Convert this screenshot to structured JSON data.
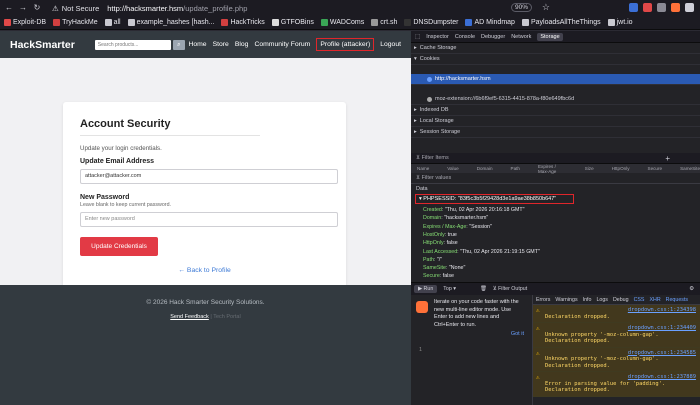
{
  "browser": {
    "security_label": "Not Secure",
    "url_host": "http://hacksmarter.hsm",
    "url_path": "/update_profile.php",
    "zoom": "90%"
  },
  "bookmarks": [
    {
      "label": "Exploit-DB",
      "color": "#e04848"
    },
    {
      "label": "TryHackMe",
      "color": "#d24040"
    },
    {
      "label": "all",
      "color": "#c9c9d0"
    },
    {
      "label": "example_hashes [hash...",
      "color": "#c9c9d0"
    },
    {
      "label": "HackTricks",
      "color": "#d24040"
    },
    {
      "label": "GTFOBins",
      "color": "#dddddd"
    },
    {
      "label": "WADComs",
      "color": "#3aa656"
    },
    {
      "label": "crt.sh",
      "color": "#999999"
    },
    {
      "label": "DNSDumpster",
      "color": "#333333"
    },
    {
      "label": "AD Mindmap",
      "color": "#3b6fd6"
    },
    {
      "label": "PayloadsAllTheThings",
      "color": "#c9c9d0"
    },
    {
      "label": "jwt.io",
      "color": "#c9c9d0"
    }
  ],
  "site": {
    "brand": "HackSmarter",
    "search_placeholder": "Search products...",
    "nav": [
      "Home",
      "Store",
      "Blog",
      "Community Forum",
      "Profile (attacker)",
      "Logout"
    ]
  },
  "card": {
    "title": "Account Security",
    "subtitle": "Update your login credentials.",
    "email_label": "Update Email Address",
    "email_value": "attacker@attacker.com",
    "password_label": "New Password",
    "password_hint": "Leave blank to keep current password.",
    "password_placeholder": "Enter new password",
    "button": "Update Credentials",
    "back_link": "← Back to Profile"
  },
  "footer": {
    "copyright": "© 2026 Hack Smarter Security Solutions.",
    "feedback": "Send Feedback",
    "feedback_sep": "|",
    "other": "Tech Portal"
  },
  "devtools": {
    "tabs": [
      "Inspector",
      "Console",
      "Debugger",
      "Network",
      "Storage"
    ],
    "tree": [
      {
        "label": "Cache Storage",
        "level": 0
      },
      {
        "label": "Cookies",
        "level": 0
      },
      {
        "label": "http://hacksmarter.hsm",
        "level": 1,
        "selected": true
      },
      {
        "label": "moz-extension://6b6f9ef5-6315-4415-878a-f80e649fbc6d",
        "level": 1
      },
      {
        "label": "Indexed DB",
        "level": 0
      },
      {
        "label": "Local Storage",
        "level": 0
      },
      {
        "label": "Session Storage",
        "level": 0
      }
    ],
    "filter_items": "Filter Items",
    "columns": [
      "Name",
      "Value",
      "Domain",
      "Path",
      "Expires / Max-Age",
      "Size",
      "HttpOnly",
      "Secure",
      "SameSite"
    ],
    "filter_values": "Filter values",
    "data_title": "Data",
    "cookie_line": "PHPSESSID: \"83f5c3b5f29428d3e1a9ae38b850b647\"",
    "cookie_props": [
      {
        "k": "Created",
        "v": "\"Thu, 02 Apr 2026 20:16:18 GMT\""
      },
      {
        "k": "Domain",
        "v": "\"hacksmarter.hsm\""
      },
      {
        "k": "Expires / Max-Age",
        "v": "\"Session\""
      },
      {
        "k": "HostOnly",
        "v": "true"
      },
      {
        "k": "HttpOnly",
        "v": "false"
      },
      {
        "k": "Last Accessed",
        "v": "\"Thu, 02 Apr 2026 21:19:15 GMT\""
      },
      {
        "k": "Path",
        "v": "\"/\""
      },
      {
        "k": "SameSite",
        "v": "\"None\""
      },
      {
        "k": "Secure",
        "v": "false"
      },
      {
        "k": "Size",
        "v": "41"
      }
    ]
  },
  "console": {
    "run": "Run",
    "top": "Top",
    "filter_output": "Filter Output",
    "tip_lines": [
      "Iterate on your code faster with the",
      "new multi-line editor mode. Use",
      "Enter to add new lines and",
      "Ctrl+Enter to run."
    ],
    "got_it": "Got it",
    "line_number": "1",
    "filter_buttons": [
      "Errors",
      "Warnings",
      "Info",
      "Logs",
      "Debug",
      "CSS",
      "XHR",
      "Requests"
    ],
    "messages": [
      {
        "text": "Declaration dropped.",
        "src": "dropdown.css:1:234398"
      },
      {
        "text": "Unknown property '-moz-column-gap'. Declaration dropped.",
        "src": "dropdown.css:1:234409"
      },
      {
        "text": "Unknown property '-moz-column-gap'. Declaration dropped.",
        "src": "dropdown.css:1:234585"
      },
      {
        "text": "Error in parsing value for 'padding'. Declaration dropped.",
        "src": "dropdown.css:1:237889"
      }
    ]
  }
}
